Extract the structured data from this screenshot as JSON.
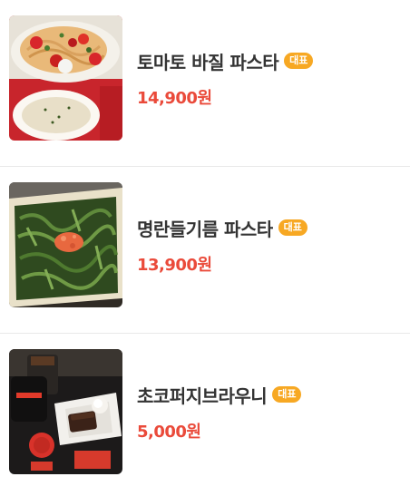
{
  "menu": {
    "items": [
      {
        "name": "토마토 바질 파스타",
        "badge": "대표",
        "price": "14,900원",
        "photo": "tomato-basil-pasta-photo"
      },
      {
        "name": "명란들기름 파스타",
        "badge": "대표",
        "price": "13,900원",
        "photo": "myeongran-perilla-oil-pasta-photo"
      },
      {
        "name": "초코퍼지브라우니",
        "badge": "대표",
        "price": "5,000원",
        "photo": "chocolate-fudge-brownie-photo"
      }
    ]
  },
  "colors": {
    "badge": "#f7a823",
    "price": "#ea4a3a",
    "name": "#333333",
    "divider": "#e8e8e8"
  }
}
